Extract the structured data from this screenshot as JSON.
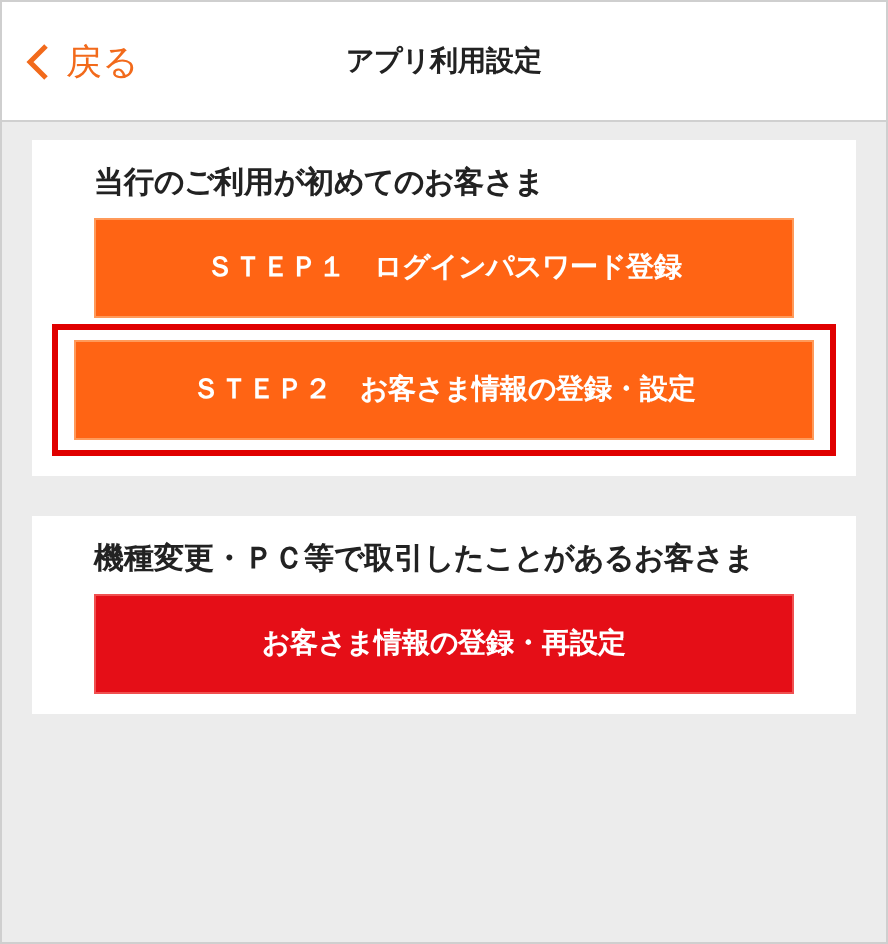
{
  "header": {
    "back_label": "戻る",
    "title": "アプリ利用設定"
  },
  "sections": [
    {
      "title": "当行のご利用が初めてのお客さま",
      "buttons": [
        {
          "label": "ＳＴＥＰ１　ログインパスワード登録",
          "kind": "primary",
          "highlighted": false
        },
        {
          "label": "ＳＴＥＰ２　お客さま情報の登録・設定",
          "kind": "primary",
          "highlighted": true
        }
      ]
    },
    {
      "title": "機種変更・ＰＣ等で取引したことがあるお客さま",
      "buttons": [
        {
          "label": "お客さま情報の登録・再設定",
          "kind": "danger",
          "highlighted": false
        }
      ]
    }
  ]
}
